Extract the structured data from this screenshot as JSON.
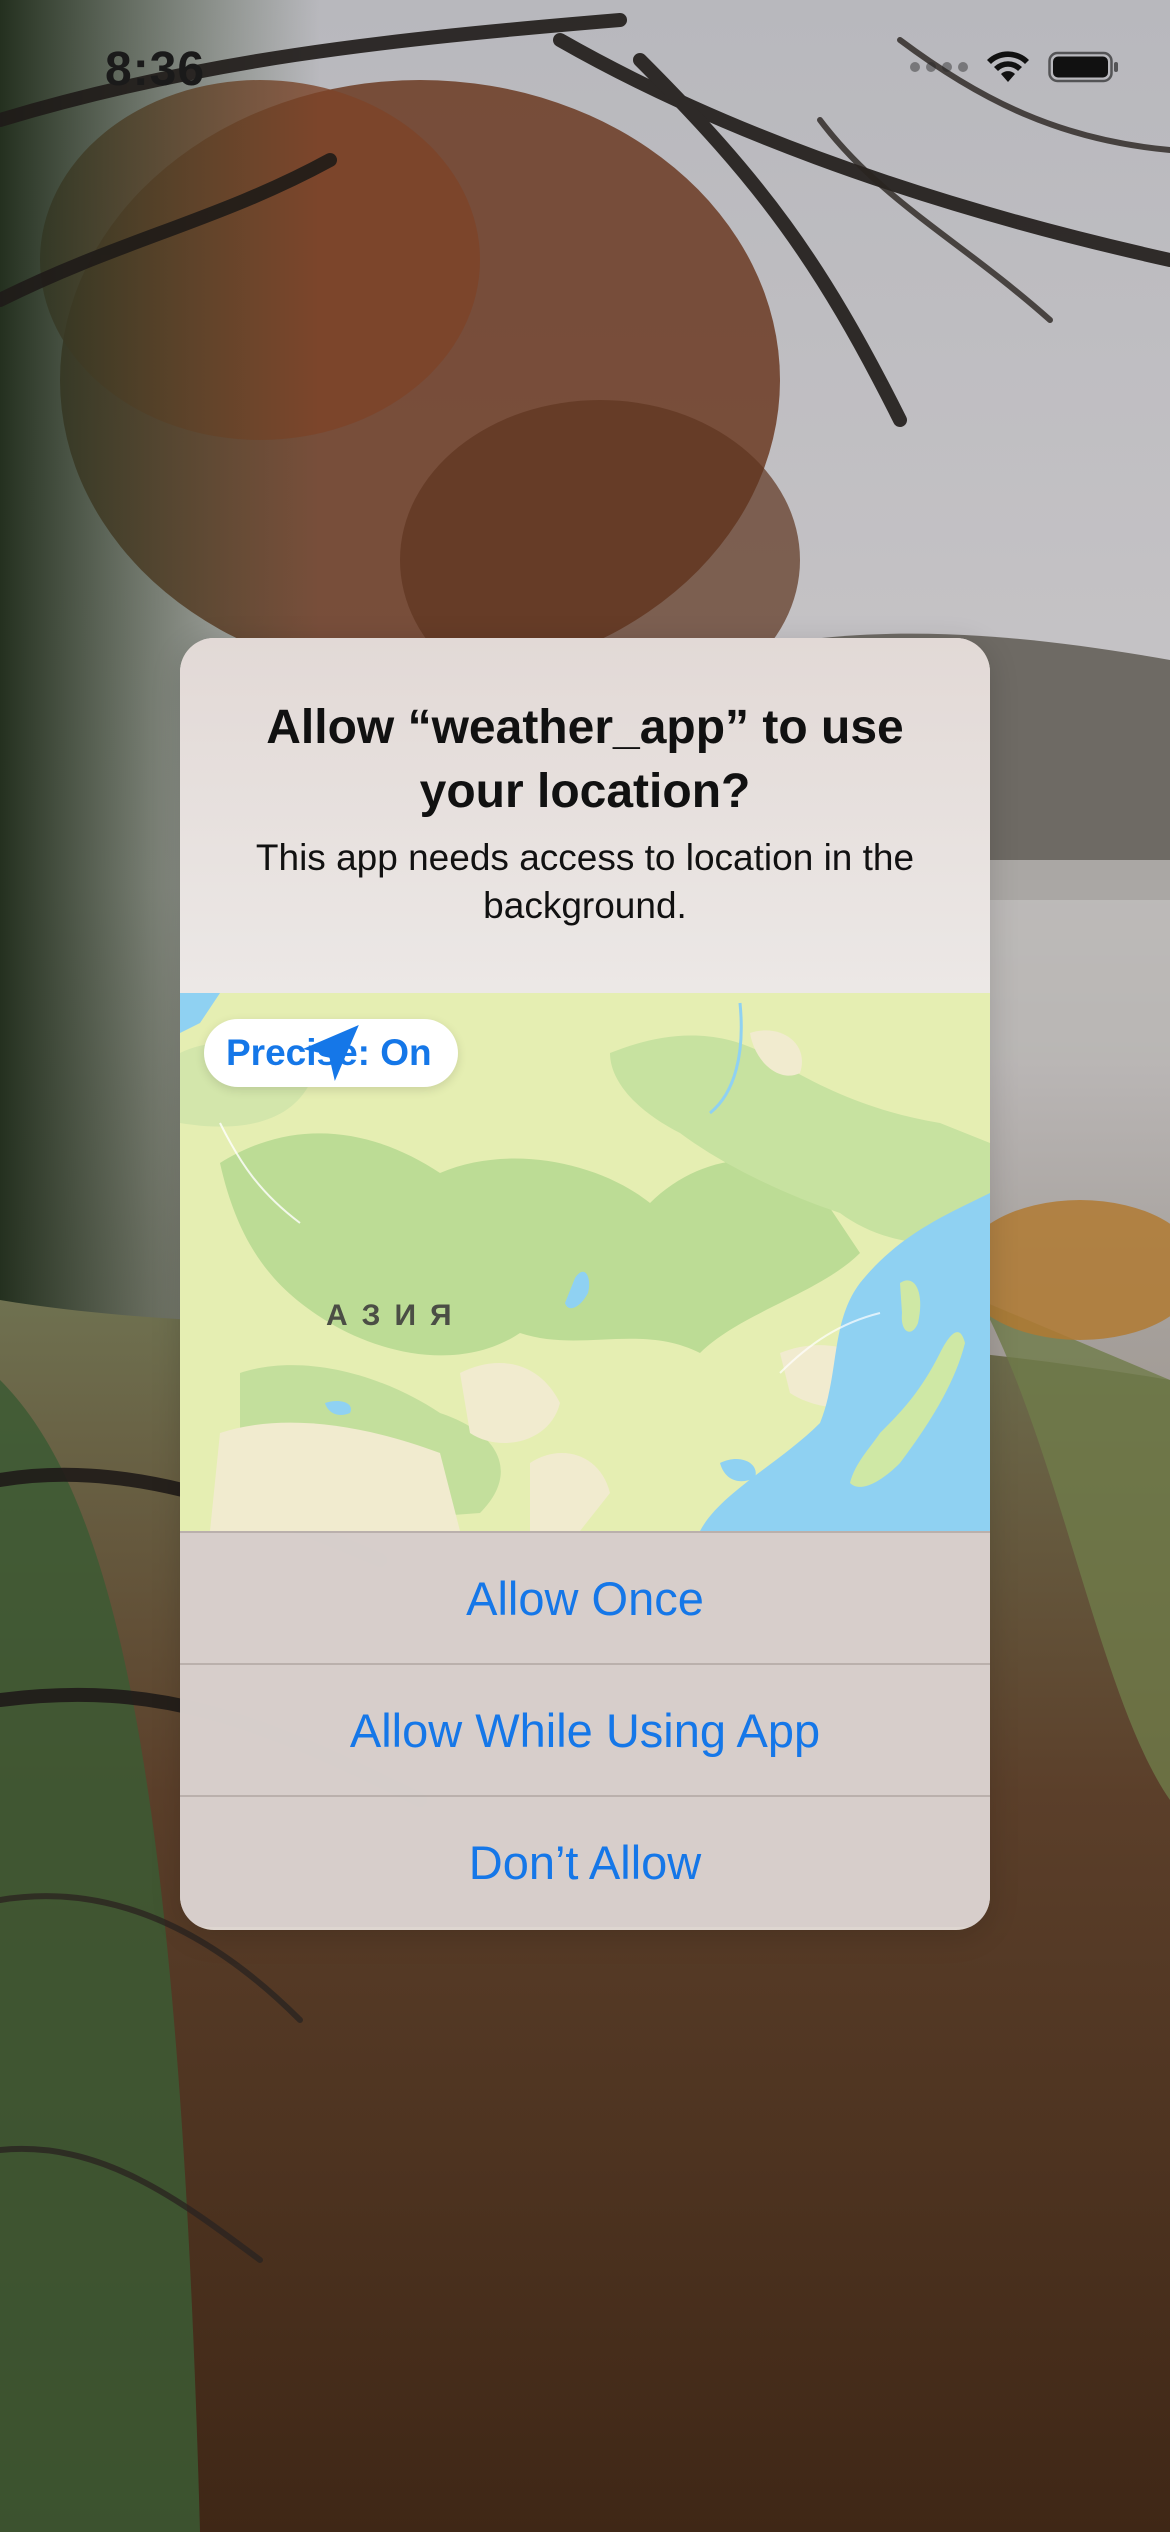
{
  "status_bar": {
    "time": "8:36"
  },
  "alert": {
    "title": "Allow “weather_app” to use your location?",
    "message": "This app needs access to location in the background.",
    "map": {
      "precise_label": "Precise: On",
      "region_label": "АЗИЯ"
    },
    "buttons": {
      "allow_once": "Allow Once",
      "allow_while_using": "Allow While Using App",
      "dont_allow": "Don’t Allow"
    }
  },
  "colors": {
    "accent": "#1577e8",
    "map_land": "#e5eeb2",
    "map_water": "#8fd1f2"
  }
}
